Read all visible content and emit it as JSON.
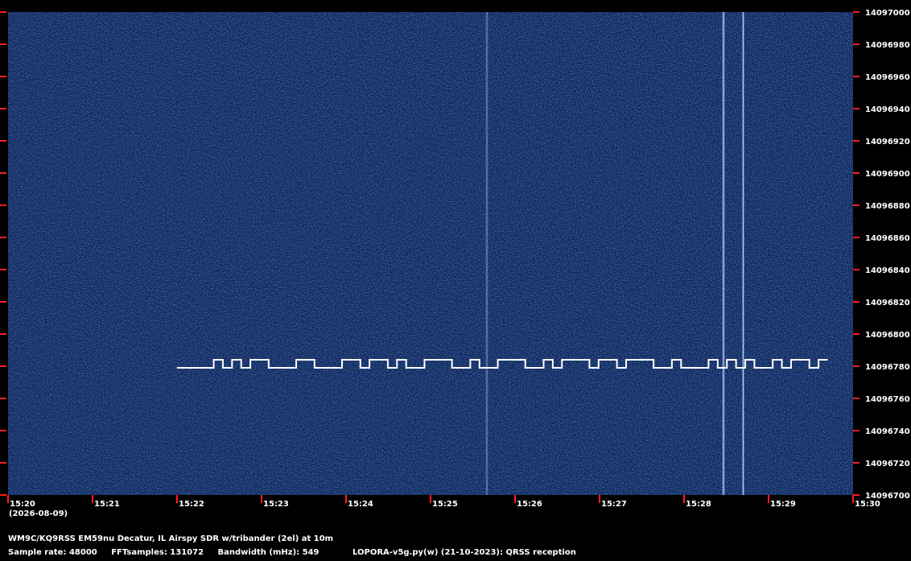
{
  "chart_data": {
    "type": "heatmap",
    "title": "",
    "xlabel": "",
    "ylabel": "",
    "x_ticks": [
      "15:20",
      "15:21",
      "15:22",
      "15:23",
      "15:24",
      "15:25",
      "15:26",
      "15:27",
      "15:28",
      "15:29",
      "15:30"
    ],
    "x_range": [
      "15:20",
      "15:30"
    ],
    "date_label": "(2026-08-09)",
    "y_ticks": [
      14097000,
      14096980,
      14096960,
      14096940,
      14096920,
      14096900,
      14096880,
      14096860,
      14096840,
      14096820,
      14096800,
      14096780,
      14096760,
      14096740,
      14096720,
      14096700
    ],
    "y_range": [
      14096700,
      14097000
    ],
    "grid": false,
    "colors": {
      "background": "#0f2658",
      "signal": "#ffffff",
      "tick": "#ff1e1e",
      "noise": "#2d5aa6"
    },
    "keyed_signal": {
      "description_color": "#ffffff",
      "start_time": "15:22",
      "end_time": "15:29:42",
      "space_freq": 14096779,
      "mark_freq": 14096784
    },
    "carriers": [
      {
        "time": "15:25:40",
        "strength": 0.35
      },
      {
        "time": "15:28:28",
        "strength": 0.8
      },
      {
        "time": "15:28:42",
        "strength": 0.7
      }
    ]
  },
  "footer": {
    "station": "WM9C/KQ9RSS EM59nu Decatur, IL  Airspy SDR w/tribander (2el) at 10m",
    "sample_rate": "Sample rate: 48000",
    "fft_samples": "FFTsamples: 131072",
    "bandwidth": "Bandwidth (mHz): 549",
    "program": "LOPORA-v5g.py(w) (21-10-2023): QRSS reception"
  }
}
